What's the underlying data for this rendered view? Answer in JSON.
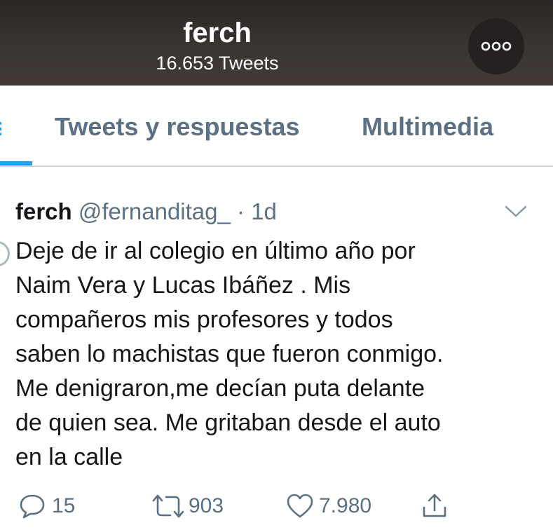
{
  "header": {
    "name": "ferch",
    "tweet_count": "16.653 Tweets",
    "more_icon": "more-dots-icon"
  },
  "tabs": [
    {
      "label": "s"
    },
    {
      "label": "Tweets y respuestas"
    },
    {
      "label": "Multimedia"
    }
  ],
  "tweet": {
    "author": "ferch",
    "handle": "@fernanditag_",
    "separator": "·",
    "time": "1d",
    "text": "Deje de ir al colegio en último año por\nNaim Vera y Lucas Ibáñez . Mis\ncompañeros mis profesores y todos\nsaben lo machistas que fueron conmigo.\nMe denigraron,me decían puta delante\nde quien sea. Me gritaban desde el auto\nen la calle",
    "reply_count": "15",
    "retweet_count": "903",
    "like_count": "7.980"
  },
  "colors": {
    "accent": "#1da1f2",
    "secondary_text": "#5b7083",
    "header_bg": "#3a3432"
  }
}
